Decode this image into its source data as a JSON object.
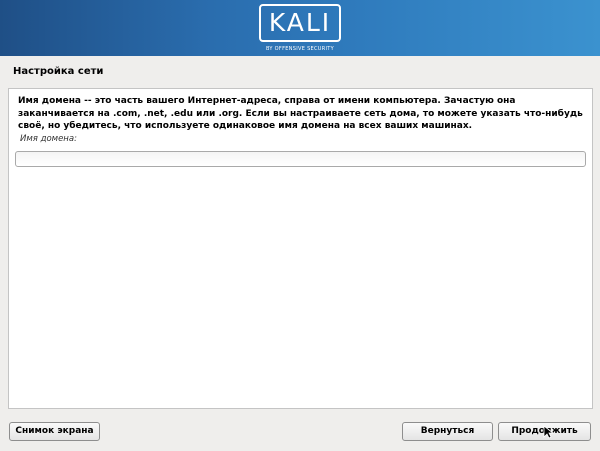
{
  "banner": {
    "logo_text": "KALI",
    "logo_subtitle": "BY OFFENSIVE SECURITY"
  },
  "page": {
    "title": "Настройка сети"
  },
  "panel": {
    "description": "Имя домена -- это часть вашего Интернет-адреса, справа от имени компьютера. Зачастую она заканчивается на .com, .net, .edu или .org. Если вы настраиваете сеть дома, то можете указать что-нибудь своё, но убедитесь, что используете одинаковое имя домена на всех ваших машинах.",
    "field_label": "Имя домена:",
    "field_value": ""
  },
  "buttons": {
    "screenshot": "Снимок экрана",
    "back": "Вернуться",
    "continue": "Продолжить"
  },
  "icons": {
    "cursor": "mouse-pointer-icon"
  }
}
